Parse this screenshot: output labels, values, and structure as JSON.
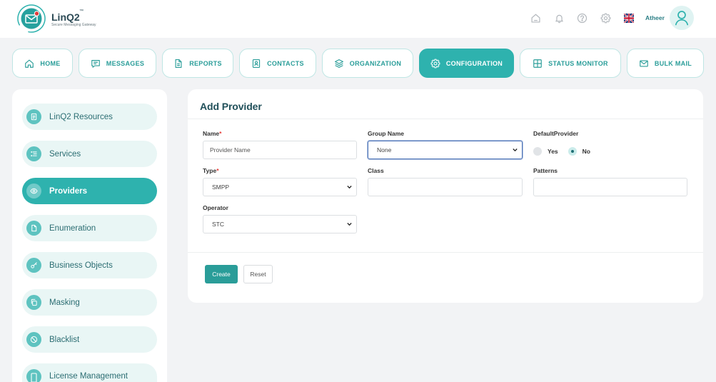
{
  "app": {
    "name": "LinQ2",
    "trademark": "™",
    "tagline": "Secure Messaging Gateway",
    "logo_icon": "envelope-logo-icon"
  },
  "header": {
    "icons": [
      "home-icon",
      "bell-icon",
      "help-icon",
      "gear-icon"
    ],
    "language_flag_icon": "uk-flag-icon",
    "user_name": "Atheer",
    "avatar_icon": "user-icon"
  },
  "nav": {
    "selected_index": 5,
    "tabs": [
      {
        "label": "HOME",
        "icon": "home-icon"
      },
      {
        "label": "MESSAGES",
        "icon": "message-icon"
      },
      {
        "label": "REPORTS",
        "icon": "document-icon"
      },
      {
        "label": "CONTACTS",
        "icon": "contact-card-icon"
      },
      {
        "label": "ORGANIZATION",
        "icon": "layers-icon"
      },
      {
        "label": "CONFIGURATION",
        "icon": "gear-icon"
      },
      {
        "label": "STATUS MONITOR",
        "icon": "grid-icon"
      },
      {
        "label": "BULK MAIL",
        "icon": "envelope-icon"
      }
    ]
  },
  "sidebar": {
    "selected_index": 2,
    "items": [
      {
        "label": "LinQ2 Resources",
        "icon": "document-list-icon"
      },
      {
        "label": "Services",
        "icon": "list-icon"
      },
      {
        "label": "Providers",
        "icon": "eye-icon"
      },
      {
        "label": "Enumeration",
        "icon": "file-icon"
      },
      {
        "label": "Business Objects",
        "icon": "key-icon"
      },
      {
        "label": "Masking",
        "icon": "copy-icon"
      },
      {
        "label": "Blacklist",
        "icon": "user-block-icon"
      },
      {
        "label": "License Management",
        "icon": "license-icon"
      }
    ]
  },
  "form": {
    "title": "Add Provider",
    "required_mark": "*",
    "fields": {
      "name": {
        "label": "Name",
        "required": true,
        "placeholder": "Provider Name",
        "value": ""
      },
      "group_name": {
        "label": "Group Name",
        "value": "None"
      },
      "default_provider": {
        "label": "DefaultProvider",
        "options": [
          "Yes",
          "No"
        ],
        "selected_index": 1
      },
      "type": {
        "label": "Type",
        "required": true,
        "value": "SMPP"
      },
      "class": {
        "label": "Class",
        "value": ""
      },
      "patterns": {
        "label": "Patterns",
        "value": ""
      },
      "operator": {
        "label": "Operator",
        "value": "STC"
      }
    },
    "buttons": {
      "create": "Create",
      "reset": "Reset"
    }
  },
  "colors": {
    "accent": "#2eb2ae",
    "button_primary": "#2a9d99",
    "title_text": "#21505a",
    "sidebar_item_bg": "#e9f6f5",
    "required_mark": "#e53935",
    "page_bg": "#f2f3f5"
  }
}
